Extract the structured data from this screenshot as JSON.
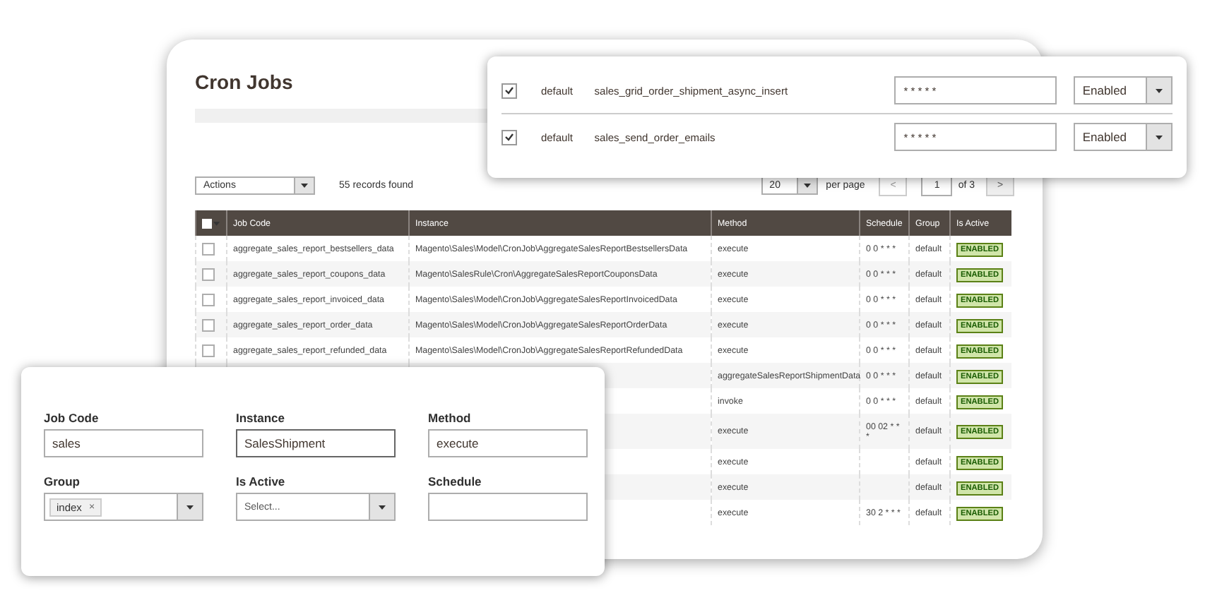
{
  "page": {
    "title": "Cron Jobs"
  },
  "toolbar": {
    "actions": "Actions",
    "records": "55 records found",
    "per_page_value": "20",
    "per_page_label": "per page",
    "prev": "<",
    "page": "1",
    "of": "of 3",
    "next": ">"
  },
  "table": {
    "select_all": {
      "checked": false
    },
    "columns": [
      "Job Code",
      "Instance",
      "Method",
      "Schedule",
      "Group",
      "Is Active"
    ],
    "rows": [
      {
        "selected": false,
        "job_code": "aggregate_sales_report_bestsellers_data",
        "instance": "Magento\\Sales\\Model\\CronJob\\AggregateSalesReportBestsellersData",
        "method": "execute",
        "schedule": "0 0 * * *",
        "group": "default",
        "status": "ENABLED"
      },
      {
        "selected": false,
        "job_code": "aggregate_sales_report_coupons_data",
        "instance": "Magento\\SalesRule\\Cron\\AggregateSalesReportCouponsData",
        "method": "execute",
        "schedule": "0 0 * * *",
        "group": "default",
        "status": "ENABLED"
      },
      {
        "selected": false,
        "job_code": "aggregate_sales_report_invoiced_data",
        "instance": "Magento\\Sales\\Model\\CronJob\\AggregateSalesReportInvoicedData",
        "method": "execute",
        "schedule": "0 0 * * *",
        "group": "default",
        "status": "ENABLED"
      },
      {
        "selected": false,
        "job_code": "aggregate_sales_report_order_data",
        "instance": "Magento\\Sales\\Model\\CronJob\\AggregateSalesReportOrderData",
        "method": "execute",
        "schedule": "0 0 * * *",
        "group": "default",
        "status": "ENABLED"
      },
      {
        "selected": false,
        "job_code": "aggregate_sales_report_refunded_data",
        "instance": "Magento\\Sales\\Model\\CronJob\\AggregateSalesReportRefundedData",
        "method": "execute",
        "schedule": "0 0 * * *",
        "group": "default",
        "status": "ENABLED"
      },
      {
        "method": "aggregateSalesReportShipmentData",
        "schedule": "0 0 * * *",
        "group": "default",
        "status": "ENABLED"
      },
      {
        "method": "invoke",
        "schedule": "0 0 * * *",
        "group": "default",
        "status": "ENABLED"
      },
      {
        "method": "execute",
        "schedule": "00 02 * * *",
        "group": "default",
        "status": "ENABLED"
      },
      {
        "method": "execute",
        "group": "default",
        "status": "ENABLED"
      },
      {
        "method": "execute",
        "group": "default",
        "status": "ENABLED"
      },
      {
        "method": "execute",
        "schedule": "30 2 * * *",
        "group": "default",
        "status": "ENABLED"
      }
    ]
  },
  "edit_card": {
    "rows": [
      {
        "checked": true,
        "group": "default",
        "job_code": "sales_grid_order_shipment_async_insert",
        "schedule": "* * * * *",
        "status": "Enabled"
      },
      {
        "checked": true,
        "group": "default",
        "job_code": "sales_send_order_emails",
        "schedule": "* * * * *",
        "status": "Enabled"
      }
    ]
  },
  "filter_card": {
    "fields": [
      {
        "kind": "text",
        "label": "Job Code",
        "value": "sales"
      },
      {
        "kind": "text",
        "label": "Instance",
        "value": "SalesShipment",
        "focused": true
      },
      {
        "kind": "text",
        "label": "Method",
        "value": "execute"
      },
      {
        "kind": "tags",
        "label": "Group",
        "tags": [
          {
            "label": "index",
            "remove": "×"
          }
        ]
      },
      {
        "kind": "select",
        "label": "Is Active",
        "placeholder": "Select..."
      },
      {
        "kind": "text",
        "label": "Schedule"
      }
    ]
  }
}
